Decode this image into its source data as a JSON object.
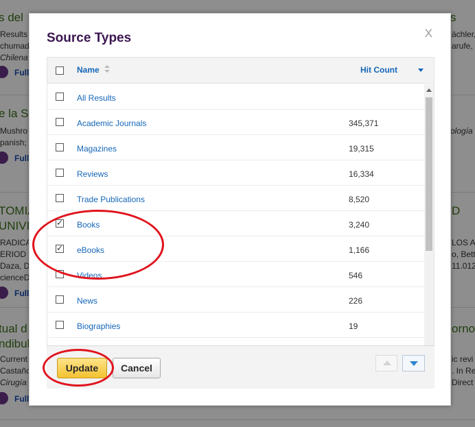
{
  "background": {
    "results": [
      {
        "title_left": "s del",
        "title_right": "s",
        "lines_left": [
          "Results",
          "chumada",
          "Chilena d"
        ],
        "lines_right": [
          "ächler,",
          "arufe, ",
          ""
        ],
        "full": "Full"
      },
      {
        "title_left": "e la S",
        "title_right": "",
        "lines_left": [
          "Mushro",
          "panish;"
        ],
        "lines_right": [
          "ología",
          ""
        ],
        "full": "Full"
      },
      {
        "title_left": "TOMIA",
        "title_left2": "UNIVI",
        "title_right": "D",
        "lines_left": [
          "RADICA",
          "ERIOD",
          "Daza, Da",
          "cienceD"
        ],
        "lines_right": [
          "LOS A",
          "o, Bett",
          "11.012",
          ""
        ],
        "full": "Full"
      },
      {
        "title_left": "tual d",
        "title_left2": "ndibul",
        "title_right": "ornos",
        "lines_left": [
          "Current",
          "Castaño",
          "Cirugía C"
        ],
        "lines_right": [
          "ic revi",
          ". In Re",
          "Direct"
        ],
        "full": "Full"
      }
    ]
  },
  "modal": {
    "title": "Source Types",
    "close_label": "X",
    "header": {
      "name_label": "Name",
      "hits_label": "Hit Count"
    },
    "rows": [
      {
        "label": "All Results",
        "count": "",
        "checked": false
      },
      {
        "label": "Academic Journals",
        "count": "345,371",
        "checked": false
      },
      {
        "label": "Magazines",
        "count": "19,315",
        "checked": false
      },
      {
        "label": "Reviews",
        "count": "16,334",
        "checked": false
      },
      {
        "label": "Trade Publications",
        "count": "8,520",
        "checked": false
      },
      {
        "label": "Books",
        "count": "3,240",
        "checked": true
      },
      {
        "label": "eBooks",
        "count": "1,166",
        "checked": true
      },
      {
        "label": "Videos",
        "count": "546",
        "checked": false
      },
      {
        "label": "News",
        "count": "226",
        "checked": false
      },
      {
        "label": "Biographies",
        "count": "19",
        "checked": false
      }
    ],
    "footer": {
      "update_label": "Update",
      "cancel_label": "Cancel"
    }
  },
  "colors": {
    "accent_link": "#1466b8",
    "title": "#3c1650",
    "update_button": "#f4c231",
    "annotation": "#e0141e"
  }
}
